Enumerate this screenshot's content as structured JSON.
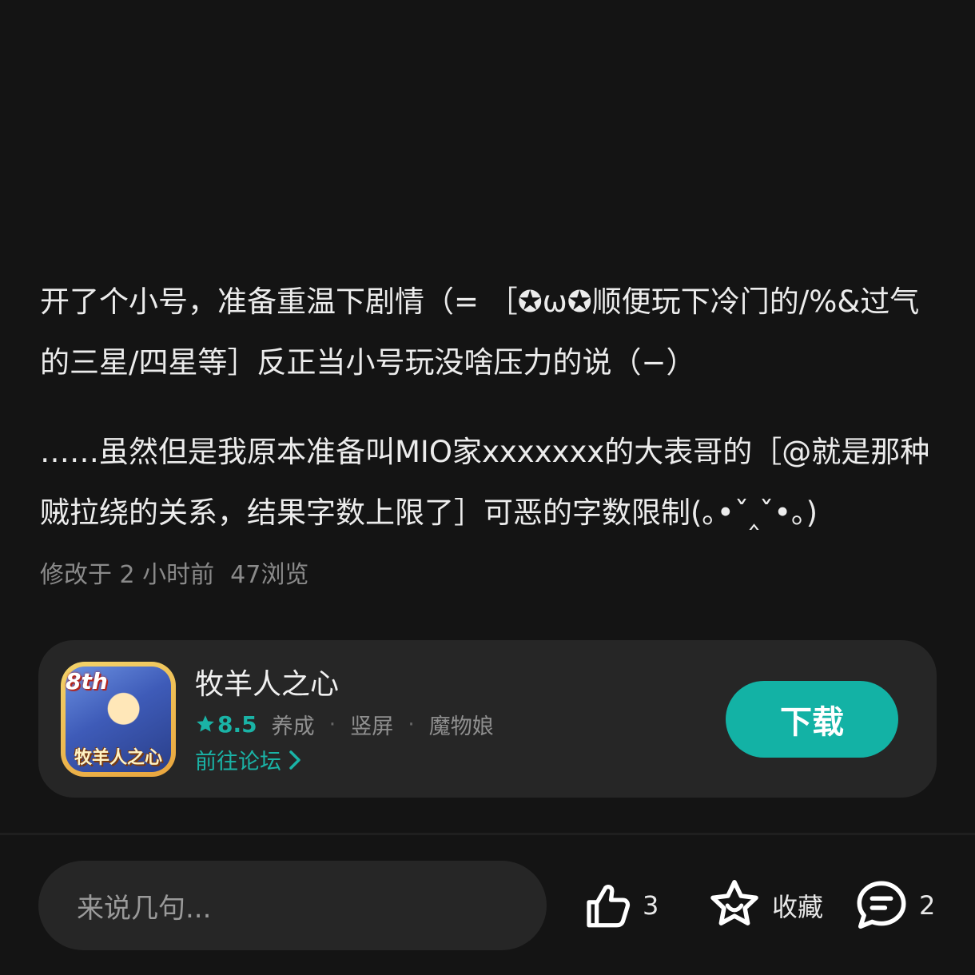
{
  "post": {
    "paragraph1": "开了个小号，准备重温下剧情（= ［✪ω✪顺便玩下冷门的/%&过气的三星/四星等］反正当小号玩没啥压力的说（−）",
    "paragraph2": "……虽然但是我原本准备叫MIO家xxxxxxx的大表哥的［@就是那种贼拉绕的关系，结果字数上限了］可恶的字数限制(｡•ˇ‸ˇ•｡)",
    "modified": "修改于 2 小时前",
    "views": "47浏览"
  },
  "game_card": {
    "icon_badge": "8th",
    "icon_logo_text": "牧羊人之心",
    "name": "牧羊人之心",
    "rating": "8.5",
    "tags": [
      "养成",
      "竖屏",
      "魔物娘"
    ],
    "tag_separator": "·",
    "forum_link": "前往论坛",
    "download_label": "下载",
    "accent_color": "#13b2a5"
  },
  "bottom_bar": {
    "comment_placeholder": "来说几句...",
    "like_count": "3",
    "favorite_label": "收藏",
    "comment_count": "2"
  }
}
